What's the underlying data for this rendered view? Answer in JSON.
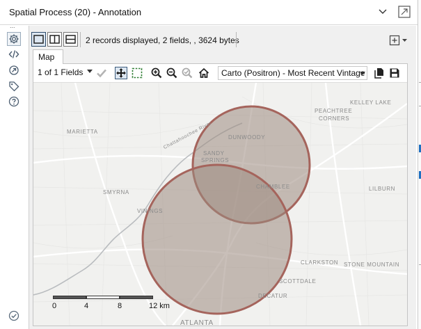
{
  "window": {
    "title": "Spatial Process (20) - Annotation",
    "ellipsis": "..."
  },
  "toolbar": {
    "records_info": "2 records displayed, 2 fields, , 3624 bytes"
  },
  "tabs": [
    {
      "label": "Map"
    }
  ],
  "map_toolbar": {
    "fields_selector": "1 of 1 Fields",
    "basemap": "Carto (Positron) - Most Recent Vintage"
  },
  "map": {
    "places": {
      "marietta": "MARIETTA",
      "dunwoody": "DUNWOODY",
      "sandy": "SANDY",
      "springs": "SPRINGS",
      "peachtree": "PEACHTREE",
      "corners": "CORNERS",
      "kelley_lake": "KELLEY LAKE",
      "smyrna": "SMYRNA",
      "vinings": "VININGS",
      "chamblee": "CHAMBLEE",
      "lilburn": "LILBURN",
      "clarkston": "CLARKSTON",
      "stone_mountain": "STONE MOUNTAIN",
      "scottdale": "SCOTTDALE",
      "decatur": "DECATUR",
      "atlanta": "ATLANTA",
      "chattahoochee_river": "Chattahoochee River"
    },
    "scale_bar": {
      "labels": [
        "0",
        "4",
        "8",
        "12 km"
      ]
    },
    "colors": {
      "circle_fill": "#9c8b80",
      "circle_stroke": "#a5645c",
      "background": "#f1f1ef",
      "roads": "#ffffff",
      "water": "#b9bcbf"
    }
  },
  "icons": {
    "left_tools": [
      "gear-icon",
      "code-icon",
      "target-icon",
      "tag-icon",
      "help-icon"
    ],
    "status": "check-circle-icon"
  }
}
